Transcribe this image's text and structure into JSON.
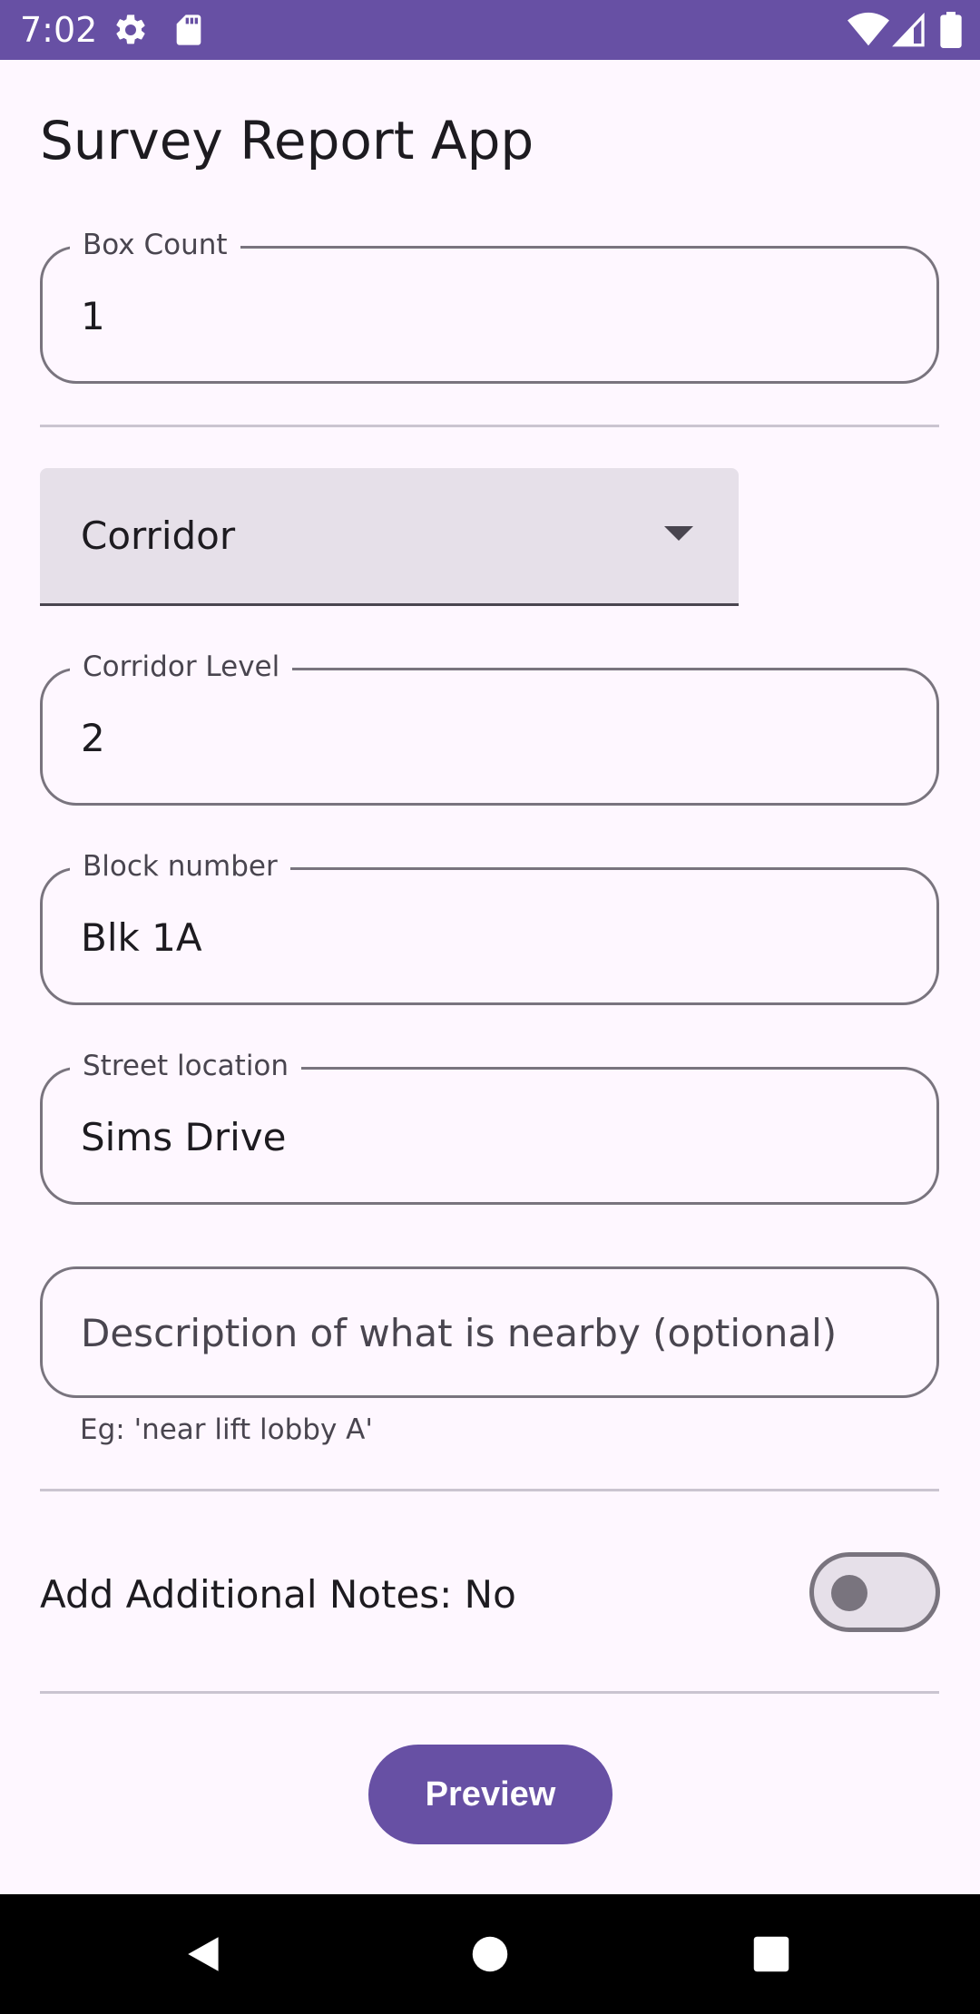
{
  "status_bar": {
    "time": "7:02",
    "icons": [
      "settings-icon",
      "sd-card-icon",
      "wifi-icon",
      "signal-icon",
      "battery-icon"
    ],
    "background": "#6750a4"
  },
  "app": {
    "title": "Survey Report App"
  },
  "form": {
    "box_count": {
      "label": "Box Count",
      "value": "1"
    },
    "location_type": {
      "selected": "Corridor"
    },
    "corridor_level": {
      "label": "Corridor Level",
      "value": "2"
    },
    "block_number": {
      "label": "Block number",
      "value": "Blk 1A"
    },
    "street_location": {
      "label": "Street location",
      "value": "Sims Drive"
    },
    "description": {
      "placeholder": "Description of what is nearby (optional)",
      "helper": "Eg: 'near lift lobby A'"
    },
    "additional_notes": {
      "label": "Add Additional Notes: No",
      "enabled": false
    }
  },
  "actions": {
    "preview_label": "Preview"
  },
  "nav_bar": {
    "icons": [
      "back-icon",
      "home-icon",
      "recents-icon"
    ]
  },
  "colors": {
    "primary": "#6750a4",
    "surface": "#fef7ff",
    "outline": "#79747e",
    "on_surface": "#1d1b20",
    "surface_variant": "#e6e0e9"
  }
}
